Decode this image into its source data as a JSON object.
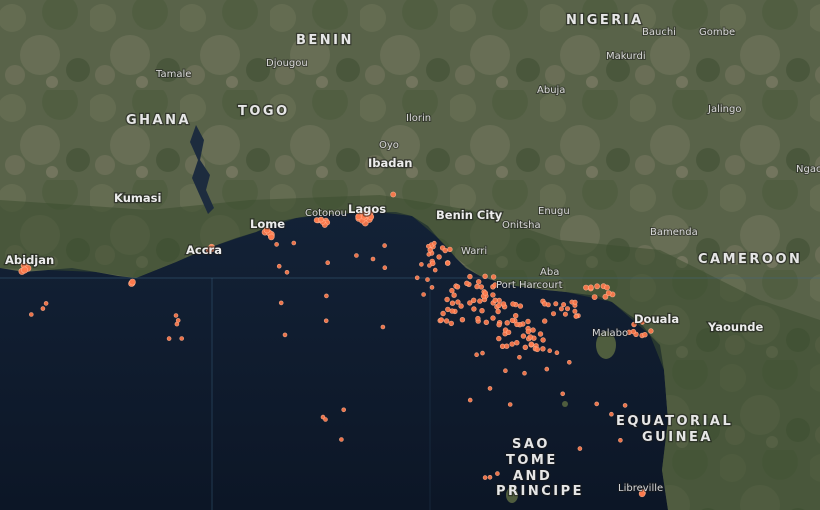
{
  "map": {
    "countries": [
      {
        "id": "nigeria",
        "text": "NIGERIA"
      },
      {
        "id": "benin",
        "text": "BENIN"
      },
      {
        "id": "togo",
        "text": "TOGO"
      },
      {
        "id": "ghana",
        "text": "GHANA"
      },
      {
        "id": "cameroon",
        "text": "CAMEROON"
      },
      {
        "id": "eq-guinea-1",
        "text": "EQUATORIAL"
      },
      {
        "id": "eq-guinea-2",
        "text": "GUINEA"
      },
      {
        "id": "stp-1",
        "text": "SAO"
      },
      {
        "id": "stp-2",
        "text": "TOME"
      },
      {
        "id": "stp-3",
        "text": "AND"
      },
      {
        "id": "stp-4",
        "text": "PRINCIPE"
      }
    ],
    "cities_major": [
      {
        "id": "kumasi",
        "text": "Kumasi"
      },
      {
        "id": "accra",
        "text": "Accra"
      },
      {
        "id": "lome",
        "text": "Lome"
      },
      {
        "id": "lagos",
        "text": "Lagos"
      },
      {
        "id": "ibadan",
        "text": "Ibadan"
      },
      {
        "id": "benin-city",
        "text": "Benin City"
      },
      {
        "id": "abidjan",
        "text": "Abidjan"
      },
      {
        "id": "yaounde",
        "text": "Yaounde"
      },
      {
        "id": "douala",
        "text": "Douala"
      }
    ],
    "cities_minor": [
      {
        "id": "tamale",
        "text": "Tamale"
      },
      {
        "id": "djougou",
        "text": "Djougou"
      },
      {
        "id": "ilorin",
        "text": "Ilorin"
      },
      {
        "id": "oyo",
        "text": "Oyo"
      },
      {
        "id": "cotonou",
        "text": "Cotonou"
      },
      {
        "id": "warri",
        "text": "Warri"
      },
      {
        "id": "onitsha",
        "text": "Onitsha"
      },
      {
        "id": "enugu",
        "text": "Enugu"
      },
      {
        "id": "aba",
        "text": "Aba"
      },
      {
        "id": "port-harcourt",
        "text": "Port Harcourt"
      },
      {
        "id": "abuja",
        "text": "Abuja"
      },
      {
        "id": "bauchi",
        "text": "Bauchi"
      },
      {
        "id": "gombe",
        "text": "Gombe"
      },
      {
        "id": "jalingo",
        "text": "Jalingo"
      },
      {
        "id": "makurdi",
        "text": "Makurdi"
      },
      {
        "id": "bamenda",
        "text": "Bamenda"
      },
      {
        "id": "malabo",
        "text": "Malabo"
      },
      {
        "id": "libreville",
        "text": "Libreville"
      },
      {
        "id": "ngaoundere",
        "text": "Ngao"
      }
    ],
    "colors": {
      "ocean": "#0f1a2c",
      "land": "#4a5a3a",
      "marker": "#ff7a4d"
    }
  }
}
